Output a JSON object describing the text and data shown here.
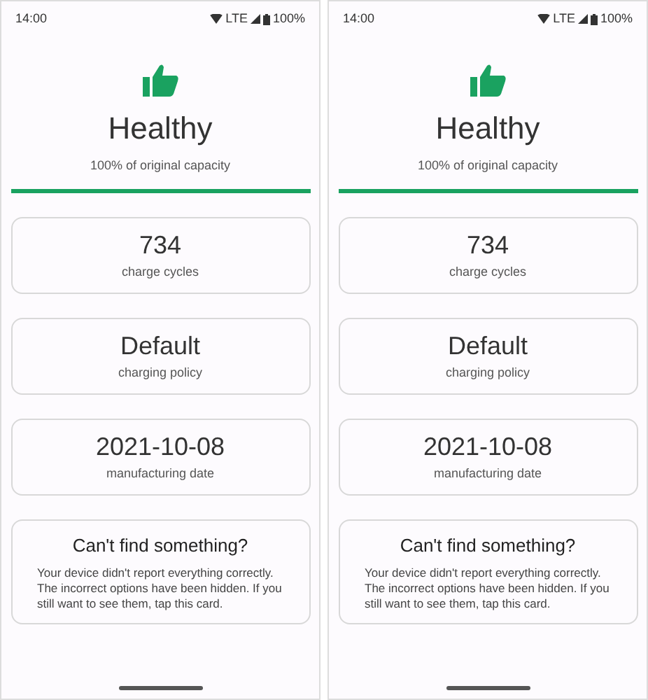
{
  "screens": [
    {
      "status_bar": {
        "time": "14:00",
        "network": "LTE",
        "battery": "100%"
      },
      "status": {
        "title": "Healthy",
        "subtitle": "100% of original capacity",
        "level": 1
      },
      "cards": [
        {
          "value": "734",
          "label": "charge cycles"
        },
        {
          "value": "Default",
          "label": "charging policy"
        },
        {
          "value": "2021-10-08",
          "label": "manufacturing date"
        }
      ],
      "notice": {
        "title": "Can't find something?",
        "text": "Your device didn't report everything correctly. The incorrect options have been hidden. If you still want to see them, tap this card."
      }
    },
    {
      "status_bar": {
        "time": "14:00",
        "network": "LTE",
        "battery": "100%"
      },
      "status": {
        "title": "Healthy",
        "subtitle": "100% of original capacity",
        "level": 1
      },
      "cards": [
        {
          "value": "734",
          "label": "charge cycles"
        },
        {
          "value": "Default",
          "label": "charging policy"
        },
        {
          "value": "2021-10-08",
          "label": "manufacturing date"
        }
      ],
      "notice": {
        "title": "Can't find something?",
        "text": "Your device didn't report everything correctly. The incorrect options have been hidden. If you still want to see them, tap this card."
      }
    }
  ]
}
